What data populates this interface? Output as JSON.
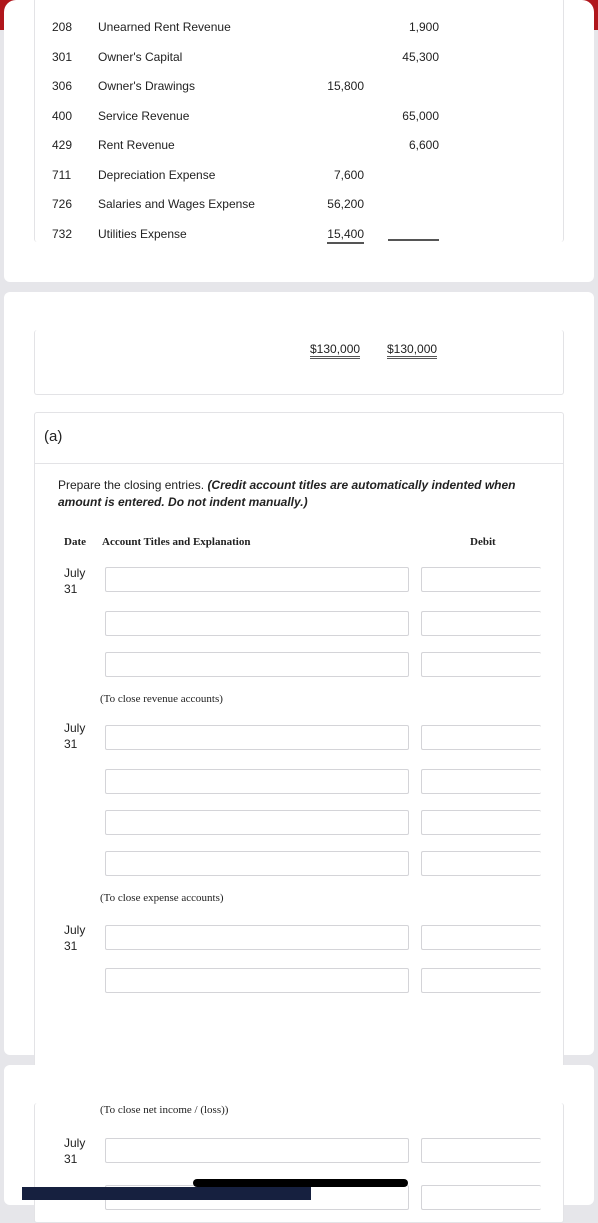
{
  "trial_balance": {
    "rows": [
      {
        "no": "208",
        "account": "Unearned Rent Revenue",
        "debit": "",
        "credit": "1,900"
      },
      {
        "no": "301",
        "account": "Owner's Capital",
        "debit": "",
        "credit": "45,300"
      },
      {
        "no": "306",
        "account": "Owner's Drawings",
        "debit": "15,800",
        "credit": ""
      },
      {
        "no": "400",
        "account": "Service Revenue",
        "debit": "",
        "credit": "65,000"
      },
      {
        "no": "429",
        "account": "Rent Revenue",
        "debit": "",
        "credit": "6,600"
      },
      {
        "no": "711",
        "account": "Depreciation Expense",
        "debit": "7,600",
        "credit": ""
      },
      {
        "no": "726",
        "account": "Salaries and Wages Expense",
        "debit": "56,200",
        "credit": ""
      },
      {
        "no": "732",
        "account": "Utilities Expense",
        "debit": "15,400",
        "credit": ""
      }
    ],
    "total_debit": "$130,000",
    "total_credit": "$130,000"
  },
  "part": {
    "label": "(a)",
    "instruction": "Prepare the closing entries.",
    "instruction_note": "(Credit account titles are automatically indented when amount is entered. Do not indent manually.)",
    "headers": {
      "date": "Date",
      "account": "Account Titles and Explanation",
      "debit": "Debit"
    },
    "entries": [
      {
        "month": "July",
        "day": "31",
        "explanation": "(To close revenue accounts)"
      },
      {
        "month": "July",
        "day": "31",
        "explanation": "(To close expense accounts)"
      },
      {
        "month": "July",
        "day": "31",
        "explanation": "(To close net income / (loss))"
      },
      {
        "month": "July",
        "day": "31",
        "explanation": ""
      }
    ]
  },
  "colors": {
    "brand": "#b0161c",
    "navy": "#16203f"
  }
}
